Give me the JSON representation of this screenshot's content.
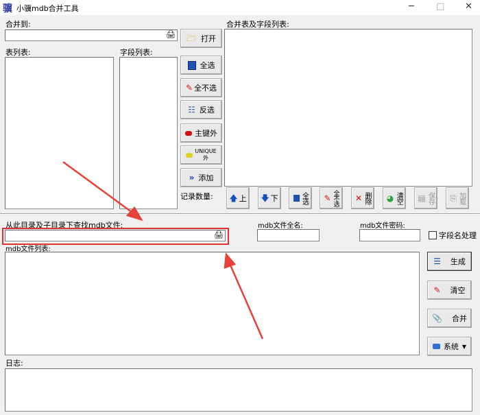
{
  "window": {
    "title": "小骥mdb合并工具",
    "minimize": "─",
    "maximize": "□",
    "close": "✕"
  },
  "top": {
    "merge_to_label": "合并到:",
    "merge_to_value": "",
    "table_list_label": "表列表:",
    "field_list_label": "字段列表:",
    "merged_list_label": "合并表及字段列表:",
    "record_count_label": "记录数量:",
    "buttons": {
      "open": "打开",
      "select_all": "全选",
      "select_none": "全不选",
      "invert": "反选",
      "outside_pk": "主键外",
      "outside_unique": "UNIQUE外",
      "add": "添加"
    },
    "small_buttons": {
      "up": "上",
      "down": "下",
      "select_all": "全选",
      "select_none": "全不选",
      "delete": "删除",
      "clear": "清空",
      "save": "保存",
      "load": "加载"
    }
  },
  "bottom": {
    "search_dir_label": "从此目录及子目录下查找mdb文件:",
    "search_dir_value": "",
    "mdb_fullname_label": "mdb文件全名:",
    "mdb_password_label": "mdb文件密码:",
    "field_name_checkbox": "字段名处理",
    "field_name_checked": false,
    "mdb_list_label": "mdb文件列表:",
    "buttons": {
      "generate": "生成",
      "clear": "清空",
      "merge": "合并",
      "system": "系统"
    },
    "log_label": "日志:"
  },
  "colors": {
    "annotation": "#e8403a",
    "highlight_box": "#e03030"
  }
}
